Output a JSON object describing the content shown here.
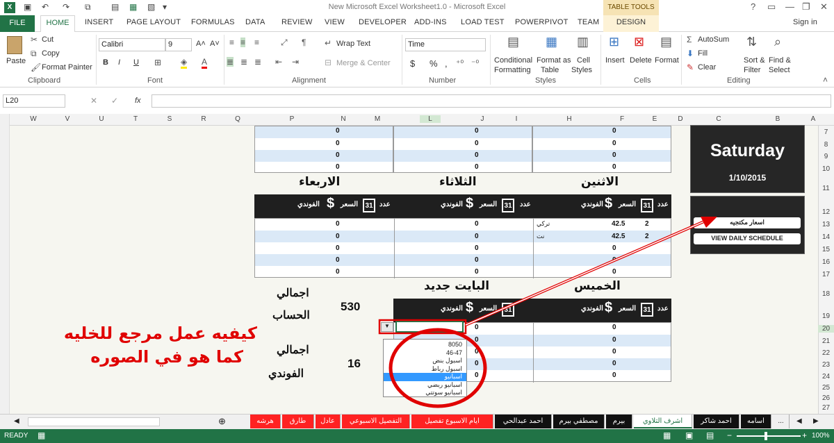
{
  "window": {
    "title": "New Microsoft Excel Worksheet1.0 - Microsoft Excel",
    "context_tab": "TABLE TOOLS",
    "help": "?",
    "minimize": "—",
    "close": "✕"
  },
  "ribbon_tabs": [
    "FILE",
    "HOME",
    "INSERT",
    "PAGE LAYOUT",
    "FORMULAS",
    "DATA",
    "REVIEW",
    "VIEW",
    "DEVELOPER",
    "ADD-INS",
    "LOAD TEST",
    "POWERPIVOT",
    "TEAM",
    "DESIGN"
  ],
  "sign_in": "Sign in",
  "clipboard": {
    "paste": "Paste",
    "cut": "Cut",
    "copy": "Copy",
    "format_painter": "Format Painter",
    "label": "Clipboard"
  },
  "font": {
    "name": "Calibri",
    "size": "9",
    "label": "Font",
    "bold": "B",
    "italic": "I",
    "underline": "U"
  },
  "alignment": {
    "wrap": "Wrap Text",
    "merge": "Merge & Center",
    "label": "Alignment"
  },
  "number": {
    "format": "Time",
    "label": "Number",
    "currency": "$",
    "percent": "%",
    "comma": ","
  },
  "styles": {
    "cond": "Conditional",
    "cond2": "Formatting",
    "fmt_table": "Format as",
    "fmt_table2": "Table",
    "cell_styles": "Cell",
    "cell_styles2": "Styles",
    "label": "Styles"
  },
  "cells": {
    "insert": "Insert",
    "delete": "Delete",
    "format": "Format",
    "label": "Cells"
  },
  "editing": {
    "autosum": "AutoSum",
    "fill": "Fill",
    "clear": "Clear",
    "sort": "Sort &",
    "sort2": "Filter",
    "find": "Find &",
    "find2": "Select",
    "label": "Editing"
  },
  "formula_bar": {
    "name_box": "L20",
    "fx": "fx",
    "value": ""
  },
  "columns": [
    "W",
    "V",
    "U",
    "T",
    "S",
    "R",
    "Q",
    "P",
    "N",
    "M",
    "L",
    "J",
    "I",
    "H",
    "F",
    "E",
    "D",
    "C",
    "B",
    "A"
  ],
  "rows": [
    "7",
    "8",
    "9",
    "10",
    "11",
    "12",
    "13",
    "14",
    "15",
    "16",
    "17",
    "18",
    "19",
    "20",
    "21",
    "22",
    "23",
    "24",
    "25",
    "26",
    "27"
  ],
  "days": {
    "wed": "الاربعاء",
    "tue": "الثلاثاء",
    "mon": "الاثنين",
    "thu": "الخميس",
    "new": "البايت جديد"
  },
  "headers": {
    "count": "عدد",
    "price": "السعر",
    "hotel": "الفوندي",
    "cal": "31"
  },
  "zero": "0",
  "mon_rows": [
    {
      "count": "2",
      "price": "42.5",
      "hotel": "تركي"
    },
    {
      "count": "2",
      "price": "42.5",
      "hotel": "نت"
    }
  ],
  "totals": {
    "label1": "اجمالي",
    "label2": "الحساب",
    "value1": "530",
    "label3": "اجمالي",
    "label4": "الفوندي",
    "value2": "16"
  },
  "panel": {
    "day": "Saturday",
    "date": "1/10/2015",
    "btn1": "اسعار مكتجيه",
    "btn2": "VIEW DAILY SCHEDULE"
  },
  "dropdown": [
    "8050",
    "46-47",
    "اسبول بنض",
    "اسبول رباط",
    "اسبانيو",
    "اسبانيو ربضي",
    "اسبانيو سوتتي"
  ],
  "annotation": [
    "كيفيه عمل مرجع للخليه",
    "كما هو في الصوره"
  ],
  "sheet_tabs": [
    "...",
    "اسامه",
    "احمد شاكر",
    "اشرف التلاوي",
    "بيرم",
    "مصطفي بيرم",
    "احمد عبدالحي",
    "ايام الاسبوع تفصيل",
    "التفصيل الاسبوعي",
    "عادل",
    "طارق",
    "هرشه"
  ],
  "status": {
    "ready": "READY",
    "zoom": "100%"
  },
  "colors": {
    "excel_green": "#217346",
    "red": "#e00000",
    "dark": "#1f1f1f",
    "row_blue": "#dbe9f7"
  }
}
